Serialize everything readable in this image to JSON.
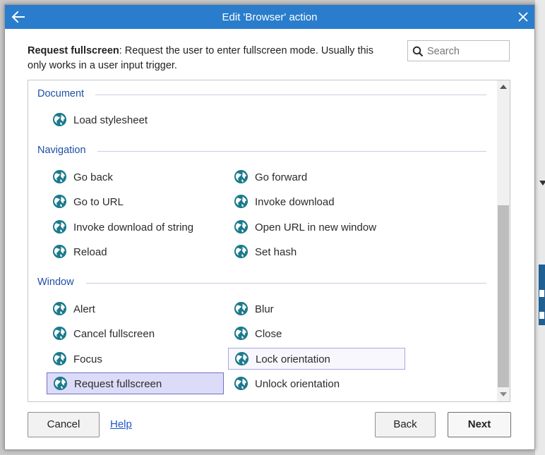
{
  "dialog": {
    "title": "Edit 'Browser' action",
    "description_bold": "Request fullscreen",
    "description_text": ": Request the user to enter fullscreen mode. Usually this only works in a user input trigger."
  },
  "search": {
    "placeholder": "Search",
    "value": ""
  },
  "sections": {
    "document": {
      "header": "Document",
      "items": [
        "Load stylesheet"
      ]
    },
    "navigation": {
      "header": "Navigation",
      "items": [
        "Go back",
        "Go forward",
        "Go to URL",
        "Invoke download",
        "Invoke download of string",
        "Open URL in new window",
        "Reload",
        "Set hash"
      ]
    },
    "window": {
      "header": "Window",
      "items": [
        "Alert",
        "Blur",
        "Cancel fullscreen",
        "Close",
        "Focus",
        "Lock orientation",
        "Request fullscreen",
        "Unlock orientation"
      ]
    }
  },
  "selected_item": "Request fullscreen",
  "hovered_item": "Lock orientation",
  "buttons": {
    "cancel": "Cancel",
    "help": "Help",
    "back": "Back",
    "next": "Next"
  },
  "colors": {
    "titlebar": "#2a7dcc",
    "section_header": "#1f4fa5",
    "selected_bg": "#dcdcf8",
    "globe_icon": "#1b7a8c"
  },
  "icons": {
    "back": "arrow-left-icon",
    "close": "close-icon",
    "search": "search-icon",
    "item": "globe-icon"
  }
}
